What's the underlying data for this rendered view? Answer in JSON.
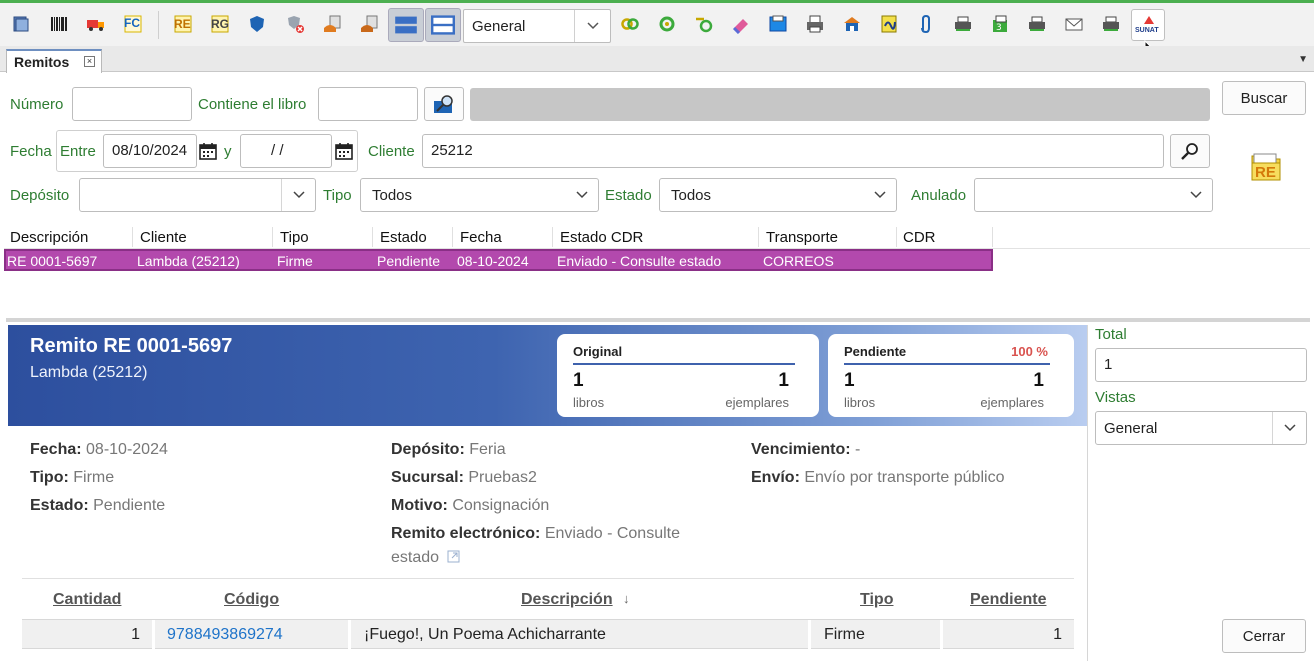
{
  "toolbar": {
    "view_selected": "General",
    "icons": [
      "books-icon",
      "barcode-icon",
      "truck-icon",
      "invoice-fc-icon",
      "remito-re-icon",
      "remito-rg-icon",
      "shield-icon",
      "shield-delete-icon",
      "return-icon",
      "return-alt-icon",
      "layout-list-icon",
      "layout-split-icon",
      "link-green-icon",
      "circle-green-icon",
      "loop-icon",
      "eraser-icon",
      "picture-icon",
      "printer-doc-icon",
      "warehouse-icon",
      "note-icon",
      "clip-icon",
      "printer-icon",
      "calc-icon",
      "printer2-icon",
      "mail-icon",
      "printer3-icon",
      "sunat-icon"
    ],
    "sunat_label": "SUNAT",
    "fc_label": "FC",
    "re_label": "RE",
    "rg_label": "RG"
  },
  "tab": {
    "label": "Remitos"
  },
  "filters": {
    "numero_label": "Número",
    "numero_value": "",
    "libro_label": "Contiene el libro",
    "libro_value": "",
    "buscar_label": "Buscar",
    "fecha_label": "Fecha",
    "entre_label": "Entre",
    "fecha_desde": "08/10/2024",
    "y_label": "y",
    "fecha_hasta": " / /",
    "cliente_label": "Cliente",
    "cliente_value": "25212",
    "deposito_label": "Depósito",
    "deposito_value": "",
    "tipo_label": "Tipo",
    "tipo_value": "Todos",
    "estado_label": "Estado",
    "estado_value": "Todos",
    "anulado_label": "Anulado",
    "anulado_value": "",
    "re_badge": "RE"
  },
  "grid": {
    "columns": [
      "Descripción",
      "Cliente",
      "Tipo",
      "Estado",
      "Fecha",
      "Estado CDR",
      "Transporte",
      "CDR"
    ],
    "rows": [
      {
        "descripcion": "RE 0001-5697",
        "cliente": "Lambda (25212)",
        "tipo": "Firme",
        "estado": "Pendiente",
        "fecha": "08-10-2024",
        "estado_cdr": "Enviado - Consulte estado",
        "transporte": "CORREOS",
        "cdr": ""
      }
    ]
  },
  "detail": {
    "title": "Remito RE 0001-5697",
    "subtitle": "Lambda (25212)",
    "original": {
      "label": "Original",
      "libros": "1",
      "libros_label": "libros",
      "ejemplares": "1",
      "ejemplares_label": "ejemplares"
    },
    "pendiente": {
      "label": "Pendiente",
      "percent": "100 %",
      "libros": "1",
      "libros_label": "libros",
      "ejemplares": "1",
      "ejemplares_label": "ejemplares"
    },
    "fields": {
      "fecha_k": "Fecha:",
      "fecha_v": "08-10-2024",
      "tipo_k": "Tipo:",
      "tipo_v": "Firme",
      "estado_k": "Estado:",
      "estado_v": "Pendiente",
      "deposito_k": "Depósito:",
      "deposito_v": "Feria",
      "sucursal_k": "Sucursal:",
      "sucursal_v": "Pruebas2",
      "motivo_k": "Motivo:",
      "motivo_v": "Consignación",
      "remito_k": "Remito electrónico:",
      "remito_v1": "Enviado - Consulte",
      "remito_v2": "estado",
      "venc_k": "Vencimiento:",
      "venc_v": "-",
      "envio_k": "Envío:",
      "envio_v": "Envío por transporte público"
    },
    "items": {
      "columns": [
        "Cantidad",
        "Código",
        "Descripción",
        "Tipo",
        "Pendiente"
      ],
      "sort_indicator": "↓",
      "rows": [
        {
          "cantidad": "1",
          "codigo": "9788493869274",
          "descripcion": "¡Fuego!, Un Poema Achicharrante",
          "tipo": "Firme",
          "pendiente": "1"
        }
      ]
    }
  },
  "right_panel": {
    "total_label": "Total",
    "total_value": "1",
    "vistas_label": "Vistas",
    "vistas_value": "General",
    "cerrar_label": "Cerrar"
  },
  "colors": {
    "accent_green": "#2e7d32",
    "selected_row": "#b349ad",
    "hero_blue": "#2d4f9e",
    "link_blue": "#1e73c9"
  }
}
